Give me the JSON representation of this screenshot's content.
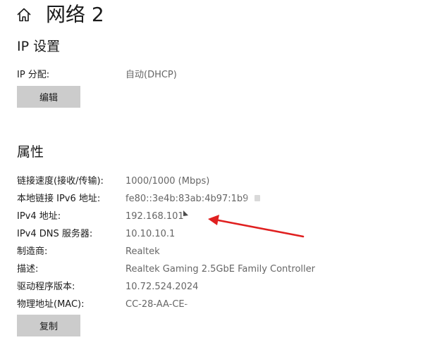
{
  "header": {
    "title": "网络 2",
    "icon": "home-icon"
  },
  "ip_settings": {
    "title": "IP 设置",
    "assignment_label": "IP 分配:",
    "assignment_value": "自动(DHCP)",
    "edit_label": "编辑"
  },
  "properties": {
    "title": "属性",
    "rows": [
      {
        "label": "链接速度(接收/传输):",
        "value": "1000/1000 (Mbps)"
      },
      {
        "label": "本地链接 IPv6 地址:",
        "value": "fe80::3e4b:83ab:4b97:1b9"
      },
      {
        "label": "IPv4 地址:",
        "value": "192.168.101"
      },
      {
        "label": "IPv4 DNS 服务器:",
        "value": "10.10.10.1"
      },
      {
        "label": "制造商:",
        "value": "Realtek"
      },
      {
        "label": "描述:",
        "value": "Realtek Gaming 2.5GbE Family Controller"
      },
      {
        "label": "驱动程序版本:",
        "value": "10.72.524.2024"
      },
      {
        "label": "物理地址(MAC):",
        "value": "CC-28-AA-CE-"
      }
    ],
    "copy_label": "复制"
  },
  "annotation": {
    "arrow_color": "#e02020",
    "target": "IPv4 地址"
  }
}
